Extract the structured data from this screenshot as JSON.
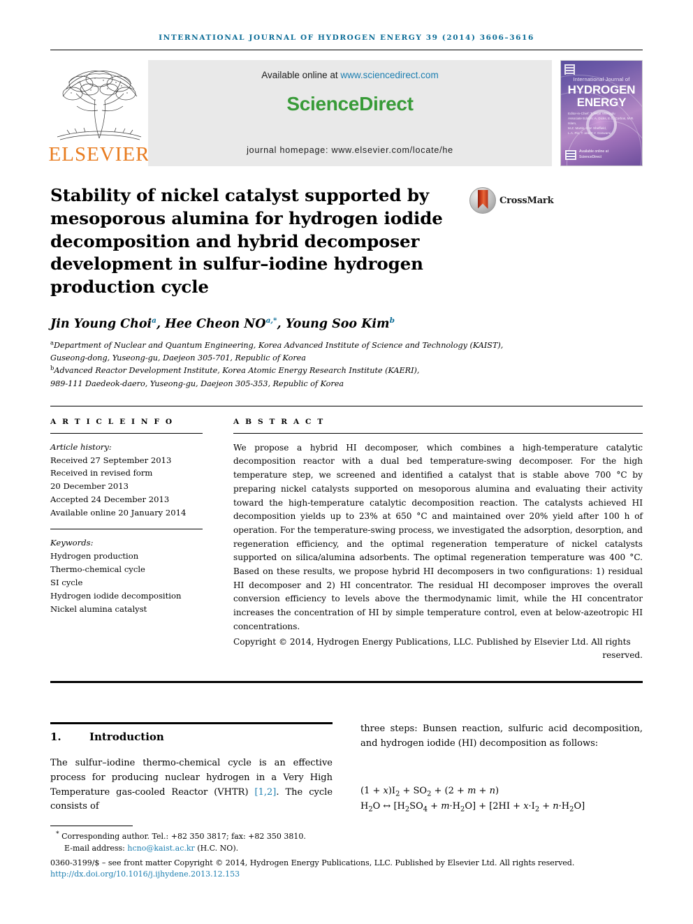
{
  "running_head": "International Journal of Hydrogen Energy 39 (2014) 3606–3616",
  "banner": {
    "publisher_logo_name": "elsevier-tree-logo",
    "publisher_word": "ELSEVIER",
    "available_prefix": "Available online at ",
    "available_url": "www.sciencedirect.com",
    "sciencedirect_logo": "ScienceDirect",
    "journal_homepage": "journal homepage: www.elsevier.com/locate/he",
    "cover": {
      "top_line": "International Journal of",
      "head_line1": "HYDROGEN",
      "head_line2": "ENERGY",
      "meta_lines": [
        "Editor-in-Chief: T. Nejat Veziroglu",
        "Associate Editors: A. Dicks, E.C. Corbos, M.R. Islam,",
        "M.Z. Martin, J.W. Sheffield,",
        "L.A. Pio, T. and D.Y. Goswami"
      ],
      "bottom_label": "Available online at",
      "bottom_brand": "ScienceDirect"
    }
  },
  "title": "Stability of nickel catalyst supported by mesoporous alumina for hydrogen iodide decomposition and hybrid decomposer development in sulfur–iodine hydrogen production cycle",
  "crossmark": {
    "label": "CrossMark",
    "icon": "crossmark-badge-icon"
  },
  "authors": {
    "list": [
      {
        "name": "Jin Young Choi",
        "marks": "a"
      },
      {
        "name": "Hee Cheon NO",
        "marks": "a,*"
      },
      {
        "name": "Young Soo Kim",
        "marks": "b"
      }
    ]
  },
  "affiliations": [
    {
      "mark": "a",
      "lines": [
        "Department of Nuclear and Quantum Engineering, Korea Advanced Institute of Science and Technology (KAIST),",
        "Guseong-dong, Yuseong-gu, Daejeon 305-701, Republic of Korea"
      ]
    },
    {
      "mark": "b",
      "lines": [
        "Advanced Reactor Development Institute, Korea Atomic Energy Research Institute (KAERI),",
        "989-111 Daedeok-daero, Yuseong-gu, Daejeon 305-353, Republic of Korea"
      ]
    }
  ],
  "article_info": {
    "heading": "A R T I C L E   I N F O",
    "history_label": "Article history:",
    "history": [
      "Received 27 September 2013",
      "Received in revised form",
      "20 December 2013",
      "Accepted 24 December 2013",
      "Available online 20 January 2014"
    ],
    "keywords_label": "Keywords:",
    "keywords": [
      "Hydrogen production",
      "Thermo-chemical cycle",
      "SI cycle",
      "Hydrogen iodide decomposition",
      "Nickel alumina catalyst"
    ]
  },
  "abstract": {
    "heading": "A B S T R A C T",
    "body": "We propose a hybrid HI decomposer, which combines a high-temperature catalytic decomposition reactor with a dual bed temperature-swing decomposer. For the high temperature step, we screened and identified a catalyst that is stable above 700 °C by preparing nickel catalysts supported on mesoporous alumina and evaluating their activity toward the high-temperature catalytic decomposition reaction. The catalysts achieved HI decomposition yields up to 23% at 650 °C and maintained over 20% yield after 100 h of operation. For the temperature-swing process, we investigated the adsorption, desorption, and regeneration efficiency, and the optimal regeneration temperature of nickel catalysts supported on silica/alumina adsorbents. The optimal regeneration temperature was 400 °C. Based on these results, we propose hybrid HI decomposers in two configurations: 1) residual HI decomposer and 2) HI concentrator. The residual HI decomposer improves the overall conversion efficiency to levels above the thermodynamic limit, while the HI concentrator increases the concentration of HI by simple temperature control, even at below-azeotropic HI concentrations.",
    "copyright": "Copyright © 2014, Hydrogen Energy Publications, LLC. Published by Elsevier Ltd. All rights",
    "copyright_last": "reserved."
  },
  "section": {
    "number": "1.",
    "title": "Introduction",
    "paragraph_pre": "The sulfur–iodine thermo-chemical cycle is an effective process for producing nuclear hydrogen in a Very High Temperature gas-cooled Reactor (VHTR) ",
    "citation": "[1,2]",
    "paragraph_post": ". The cycle consists of",
    "right_paragraph": "three steps: Bunsen reaction, sulfuric acid decomposition, and hydrogen iodide (HI) decomposition as follows:",
    "equation_line1": "(1 + x)I2 + SO2 + (2 + m + n)",
    "equation_line2": "H2O ↔ [H2SO4 + m·H2O] + [2HI + x·I2 + n·H2O]"
  },
  "footer": {
    "corresponding": "Corresponding author. Tel.: +82 350 3817; fax: +82 350 3810.",
    "email_label": "E-mail address: ",
    "email": "hcno@kaist.ac.kr",
    "email_suffix": " (H.C. NO).",
    "front_matter": "0360-3199/$ – see front matter Copyright © 2014, Hydrogen Energy Publications, LLC. Published by Elsevier Ltd. All rights reserved.",
    "doi": "http://dx.doi.org/10.1016/j.ijhydene.2013.12.153"
  },
  "colors": {
    "link_blue": "#1b7eb0",
    "elsevier_orange": "#e87b1e",
    "sciencedirect_green": "#389b38",
    "crossmark_red": "#d3441f"
  }
}
